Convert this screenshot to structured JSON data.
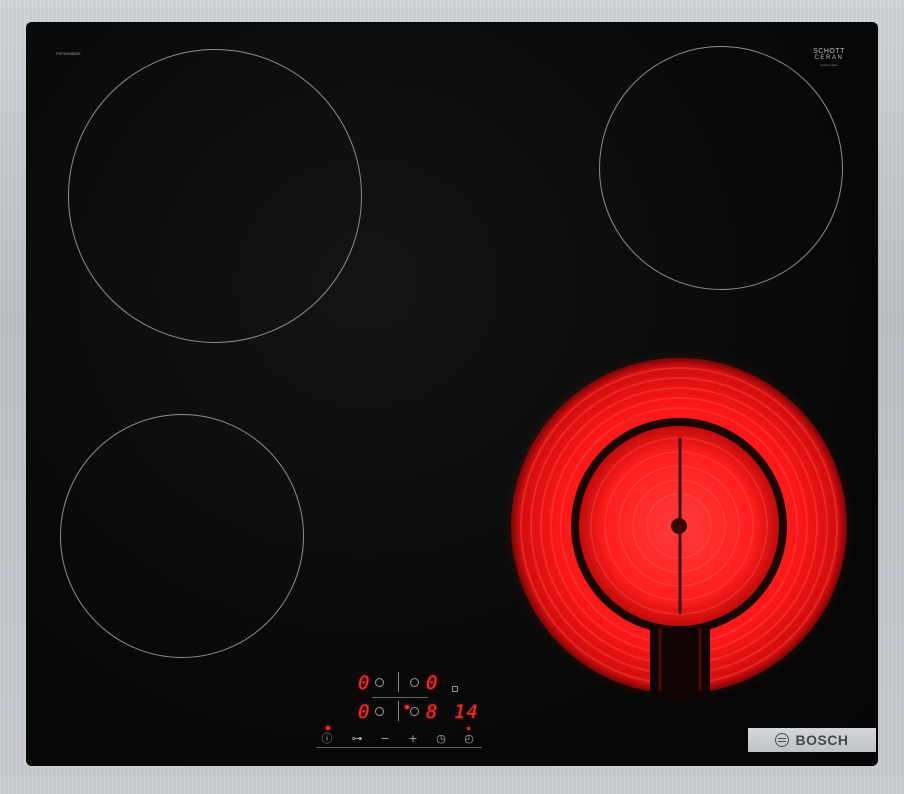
{
  "cooktop": {
    "model_code": "PKF645BB2E",
    "glass_brand_line1": "SCHOTT",
    "glass_brand_line2": "CERAN",
    "glass_brand_line3": "ceramic glass",
    "brand": "BOSCH",
    "zones": [
      {
        "name": "rear-left",
        "state": "off"
      },
      {
        "name": "rear-right",
        "state": "off"
      },
      {
        "name": "front-left",
        "state": "off"
      },
      {
        "name": "front-right",
        "state": "on",
        "color": "#ff1f1f"
      }
    ]
  },
  "control_panel": {
    "displays": {
      "rear_left": "0",
      "rear_right": "0",
      "front_left": "0",
      "front_right": "8",
      "timer": "14"
    },
    "buttons": {
      "power": "ⓘ",
      "lock": "⊶",
      "minus": "−",
      "plus": "+",
      "timer_select": "◷",
      "clock": "◴"
    }
  },
  "colors": {
    "glass": "#070707",
    "frame": "#c3c6ca",
    "display_red": "#ff2626",
    "hot_zone": "#ff1f1f"
  }
}
